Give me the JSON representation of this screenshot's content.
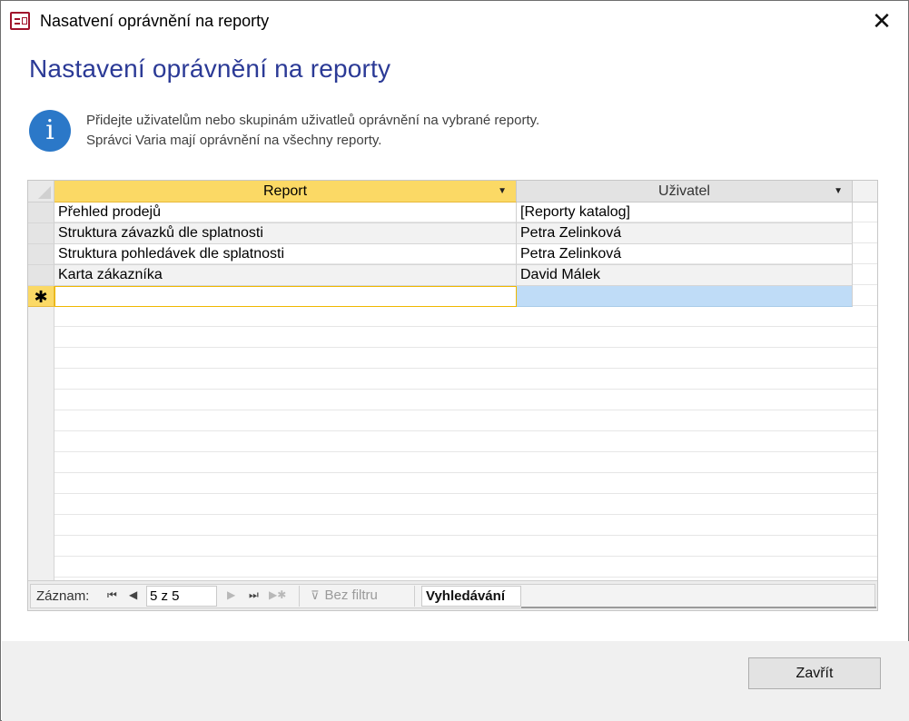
{
  "window": {
    "title": "Nasatvení oprávnění na reporty",
    "close_glyph": "✕"
  },
  "page": {
    "title": "Nastavení oprávnění na reporty"
  },
  "info": {
    "icon": "info-icon",
    "glyph": "i",
    "line1": "Přidejte uživatelům nebo skupinám uživatleů oprávnění na vybrané reporty.",
    "line2": "Správci Varia mají oprávnění na všechny reporty."
  },
  "grid": {
    "columns": [
      {
        "label": "Report"
      },
      {
        "label": "Uživatel"
      }
    ],
    "rows": [
      {
        "report": "Přehled prodejů",
        "user": "[Reporty katalog]"
      },
      {
        "report": "Struktura závazků dle splatnosti",
        "user": "Petra Zelinková"
      },
      {
        "report": "Struktura pohledávek dle splatnosti",
        "user": "Petra Zelinková"
      },
      {
        "report": "Karta zákazníka",
        "user": "David Málek"
      }
    ],
    "new_row_marker": "✱",
    "dropdown_glyph": "⌵",
    "sort_glyph": "▼"
  },
  "navigator": {
    "label": "Záznam:",
    "first": "⏮",
    "prev": "◀",
    "position": "5 z 5",
    "next": "▶",
    "last": "⏭",
    "new": "▶✱",
    "filter_icon": "⊽",
    "filter_label": "Bez filtru",
    "search_value": "Vyhledávání"
  },
  "footer": {
    "close_label": "Zavřít"
  }
}
